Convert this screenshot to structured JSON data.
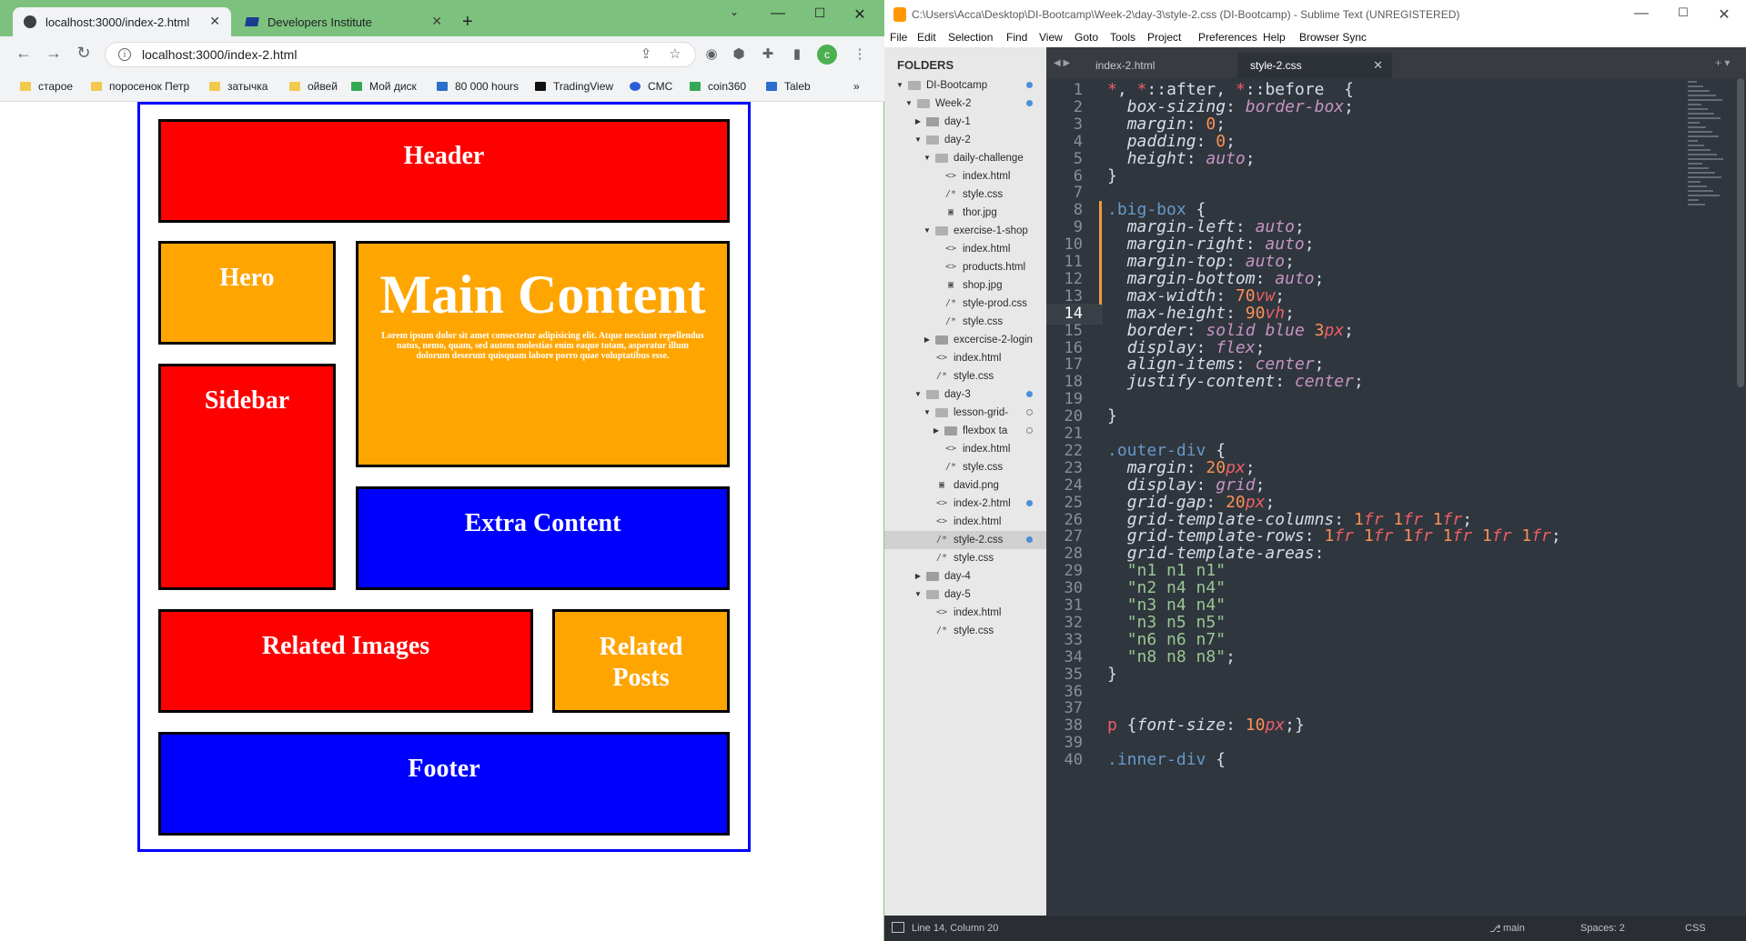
{
  "chrome": {
    "tabs": [
      {
        "title": "localhost:3000/index-2.html"
      },
      {
        "title": "Developers Institute"
      }
    ],
    "new_tab": "+",
    "url": "localhost:3000/index-2.html",
    "bookmarks": [
      "старое",
      "поросенок Петр",
      "затычка",
      "ойвей",
      "Мой диск",
      "80 000 hours",
      "TradingView",
      "CMC",
      "coin360",
      "Taleb"
    ],
    "profile_initial": "c",
    "more_bookmarks": "»"
  },
  "page": {
    "header": "Header",
    "hero": "Hero",
    "main_title": "Main Content",
    "main_text": "Lorem ipsum dolor sit amet consectetur adipisicing elit. Atque nesciunt repellendus natus, nemo, quam, sed autem molestias enim eaque totam, asperatur illum dolorum deserunt quisquam labore porro quae voluptatibus esse.",
    "sidebar": "Sidebar",
    "extra": "Extra Content",
    "related_images": "Related Images",
    "related_posts_line1": "Related",
    "related_posts_line2": "Posts",
    "footer": "Footer",
    "colors": {
      "red": "#ff0000",
      "orange": "#ffa500",
      "blue": "#0000ff",
      "frame": "#0000ff"
    }
  },
  "sublime": {
    "title": "C:\\Users\\Acca\\Desktop\\DI-Bootcamp\\Week-2\\day-3\\style-2.css (DI-Bootcamp) - Sublime Text (UNREGISTERED)",
    "menu": [
      "File",
      "Edit",
      "Selection",
      "Find",
      "View",
      "Goto",
      "Tools",
      "Project",
      "Preferences",
      "Help",
      "Browser Sync"
    ],
    "folders_header": "FOLDERS",
    "tree": [
      {
        "label": "DI-Bootcamp"
      },
      {
        "label": "Week-2"
      },
      {
        "label": "day-1"
      },
      {
        "label": "day-2"
      },
      {
        "label": "daily-challenge"
      },
      {
        "label": "index.html"
      },
      {
        "label": "style.css"
      },
      {
        "label": "thor.jpg"
      },
      {
        "label": "exercise-1-shop"
      },
      {
        "label": "index.html"
      },
      {
        "label": "products.html"
      },
      {
        "label": "shop.jpg"
      },
      {
        "label": "style-prod.css"
      },
      {
        "label": "style.css"
      },
      {
        "label": "excercise-2-login"
      },
      {
        "label": "index.html"
      },
      {
        "label": "style.css"
      },
      {
        "label": "day-3"
      },
      {
        "label": "lesson-grid-"
      },
      {
        "label": "flexbox ta"
      },
      {
        "label": "index.html"
      },
      {
        "label": "style.css"
      },
      {
        "label": "david.png"
      },
      {
        "label": "index-2.html"
      },
      {
        "label": "index.html"
      },
      {
        "label": "style-2.css"
      },
      {
        "label": "style.css"
      },
      {
        "label": "day-4"
      },
      {
        "label": "day-5"
      },
      {
        "label": "index.html"
      },
      {
        "label": "style.css"
      }
    ],
    "tabs": [
      {
        "title": "index-2.html"
      },
      {
        "title": "style-2.css"
      }
    ],
    "line_numbers": [
      "1",
      "2",
      "3",
      "4",
      "5",
      "6",
      "7",
      "8",
      "9",
      "10",
      "11",
      "12",
      "13",
      "14",
      "15",
      "16",
      "17",
      "18",
      "19",
      "20",
      "21",
      "22",
      "23",
      "24",
      "25",
      "26",
      "27",
      "28",
      "29",
      "30",
      "31",
      "32",
      "33",
      "34",
      "35",
      "36",
      "37",
      "38",
      "39",
      "40"
    ],
    "code": [
      "*, *::after, *::before  {",
      "  box-sizing: border-box;",
      "  margin: 0;",
      "  padding: 0;",
      "  height: auto;",
      "}",
      "",
      ".big-box {",
      "  margin-left: auto;",
      "  margin-right: auto;",
      "  margin-top: auto;",
      "  margin-bottom: auto;",
      "  max-width: 70vw;",
      "  max-height: 90vh;",
      "  border: solid blue 3px;",
      "  display: flex;",
      "  align-items: center;",
      "  justify-content: center;",
      "",
      "}",
      "",
      ".outer-div {",
      "  margin: 20px;",
      "  display: grid;",
      "  grid-gap: 20px;",
      "  grid-template-columns: 1fr 1fr 1fr;",
      "  grid-template-rows: 1fr 1fr 1fr 1fr 1fr 1fr;",
      "  grid-template-areas:",
      "  \"n1 n1 n1\"",
      "  \"n2 n4 n4\"",
      "  \"n3 n4 n4\"",
      "  \"n3 n5 n5\"",
      "  \"n6 n6 n7\"",
      "  \"n8 n8 n8\";",
      "}",
      "",
      "",
      "p {font-size: 10px;}",
      "",
      ".inner-div {"
    ],
    "status": {
      "position": "Line 14, Column 20",
      "branch": "main",
      "spaces": "Spaces: 2",
      "syntax": "CSS"
    }
  }
}
